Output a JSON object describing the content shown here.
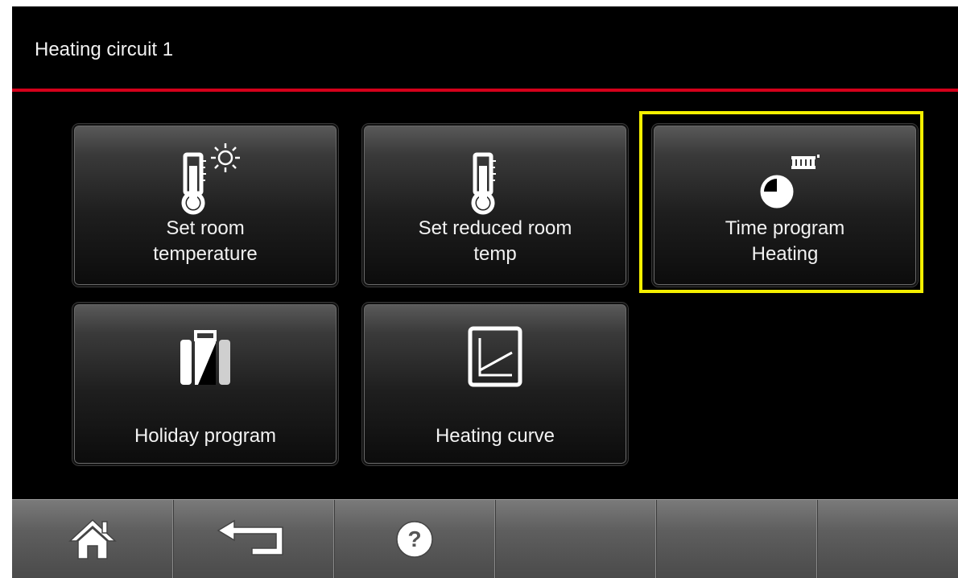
{
  "header": {
    "title": "Heating circuit 1"
  },
  "tiles": [
    {
      "label": "Set room\ntemperature",
      "icon": "thermometer-sun-icon"
    },
    {
      "label": "Set reduced room\ntemp",
      "icon": "thermometer-moon-icon"
    },
    {
      "label": "Time program\nHeating",
      "icon": "clock-radiator-icon",
      "selected": true
    },
    {
      "label": "Holiday program",
      "icon": "suitcase-icon"
    },
    {
      "label": "Heating curve",
      "icon": "heating-curve-icon"
    }
  ],
  "nav": [
    {
      "name": "home",
      "icon": "home-icon"
    },
    {
      "name": "back",
      "icon": "back-arrow-icon"
    },
    {
      "name": "help",
      "icon": "help-icon",
      "glyph": "?"
    },
    {
      "name": "empty-1"
    },
    {
      "name": "empty-2"
    },
    {
      "name": "empty-3"
    }
  ],
  "colors": {
    "accent_line": "#d4001a",
    "selection": "#f5f000",
    "background": "#000000"
  }
}
